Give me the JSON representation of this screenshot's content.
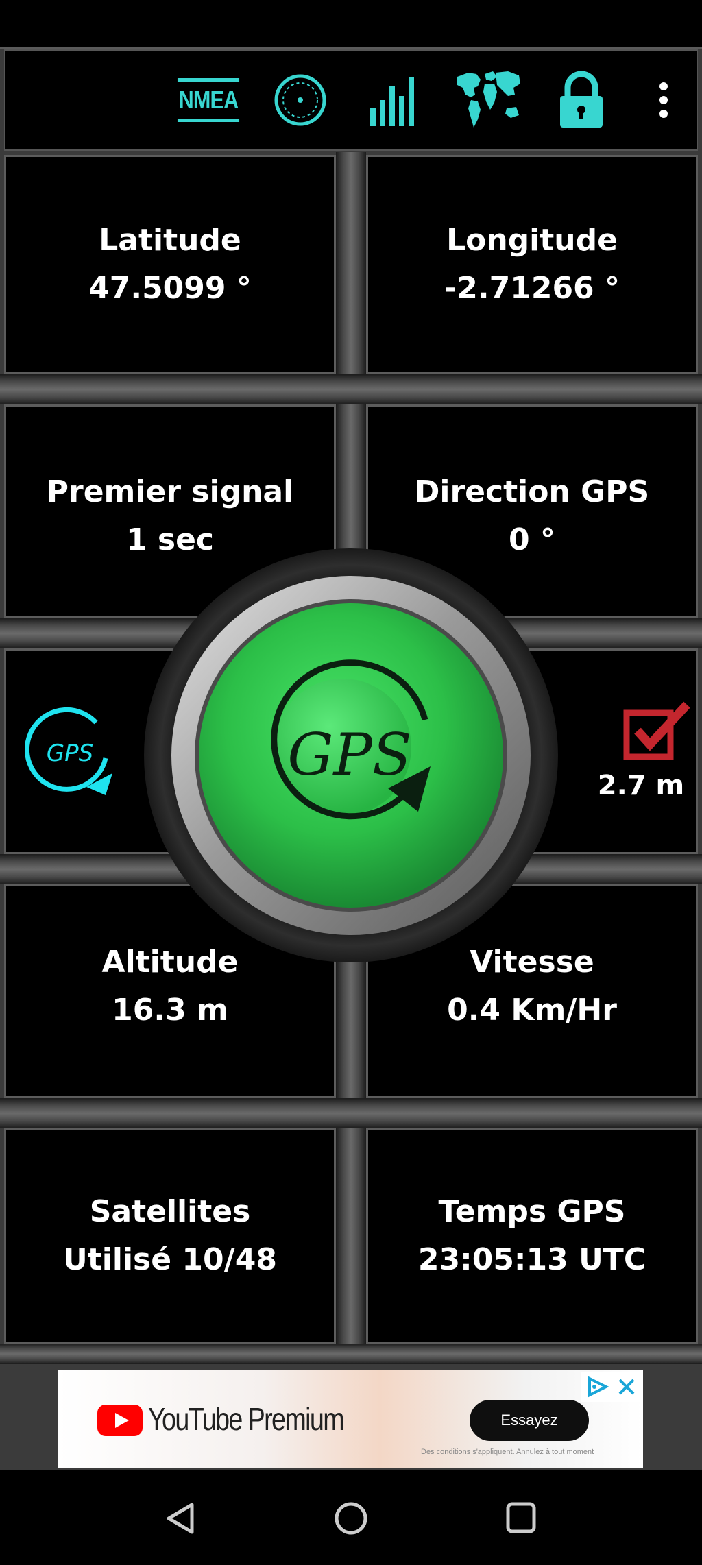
{
  "toolbar": {
    "nmea_label": "NMEA",
    "icons": [
      "radar-icon",
      "signal-bars-icon",
      "world-map-icon",
      "lock-icon",
      "overflow-menu-icon"
    ]
  },
  "cells": {
    "latitude": {
      "label": "Latitude",
      "value": "47.5099 °"
    },
    "longitude": {
      "label": "Longitude",
      "value": "-2.71266 °"
    },
    "first_signal": {
      "label": "Premier signal",
      "value": "1 sec"
    },
    "gps_direction": {
      "label": "Direction GPS",
      "value": "0 °"
    },
    "altitude": {
      "label": "Altitude",
      "value": "16.3 m"
    },
    "speed": {
      "label": "Vitesse",
      "value": "0.4 Km/Hr"
    },
    "satellites": {
      "label": "Satellites",
      "value": "Utilisé 10/48"
    },
    "gps_time": {
      "label": "Temps GPS",
      "value": "23:05:13 UTC"
    }
  },
  "gps_button": {
    "label": "GPS"
  },
  "side": {
    "refresh_label": "GPS",
    "accuracy": "2.7 m"
  },
  "ad": {
    "brand": "YouTube Premium",
    "cta": "Essayez",
    "fine_print": "Des conditions s'appliquent. Annulez à tout moment"
  },
  "colors": {
    "accent": "#38d6d0",
    "gps_green": "#2fbf4a",
    "check_red": "#c4262e",
    "background": "#000000"
  }
}
